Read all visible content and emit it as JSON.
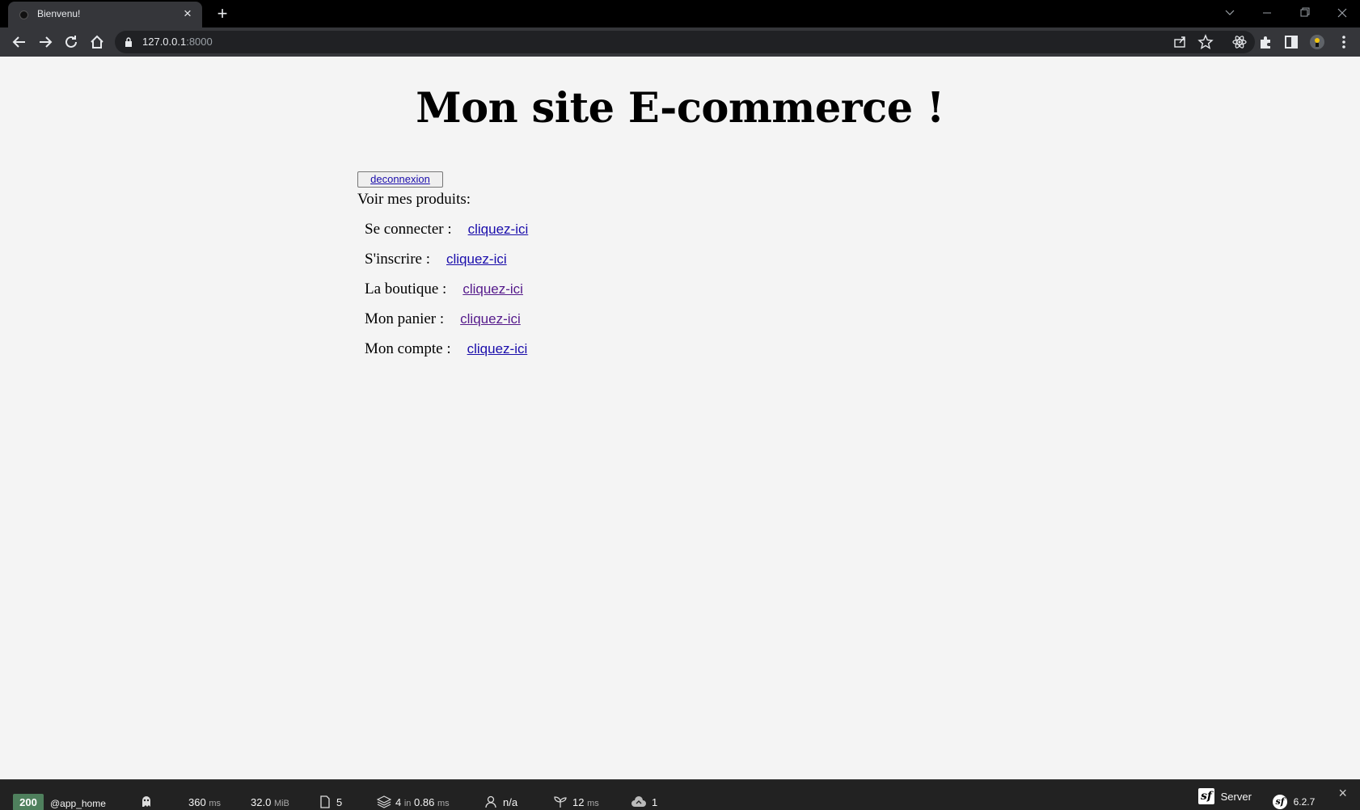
{
  "browser": {
    "tab_title": "Bienvenu!",
    "url_host": "127.0.0.1",
    "url_port": ":8000"
  },
  "page": {
    "title": "Mon site E-commerce !",
    "logout_label": "deconnexion",
    "products_label": "Voir mes produits:",
    "links": [
      {
        "label": "Se connecter :",
        "link_text": "cliquez-ici",
        "state": "unvisited"
      },
      {
        "label": "S'inscrire :",
        "link_text": "cliquez-ici",
        "state": "unvisited"
      },
      {
        "label": "La boutique :",
        "link_text": "cliquez-ici",
        "state": "visited"
      },
      {
        "label": "Mon panier :",
        "link_text": "cliquez-ici",
        "state": "visited"
      },
      {
        "label": "Mon compte :",
        "link_text": "cliquez-ici",
        "state": "unvisited"
      }
    ]
  },
  "debug_toolbar": {
    "status_code": "200",
    "route": "@app_home",
    "time_value": "360",
    "time_unit": "ms",
    "memory_value": "32.0",
    "memory_unit": "MiB",
    "logs_count": "5",
    "cache_value": "4",
    "cache_in": "in",
    "cache_time": "0.86",
    "cache_unit": "ms",
    "user": "n/a",
    "twig_value": "12",
    "twig_unit": "ms",
    "deploy_count": "1",
    "server_label": "Server",
    "symfony_version": "6.2.7",
    "colors": {
      "status_ok": "#4f805d",
      "background": "#222222"
    }
  }
}
